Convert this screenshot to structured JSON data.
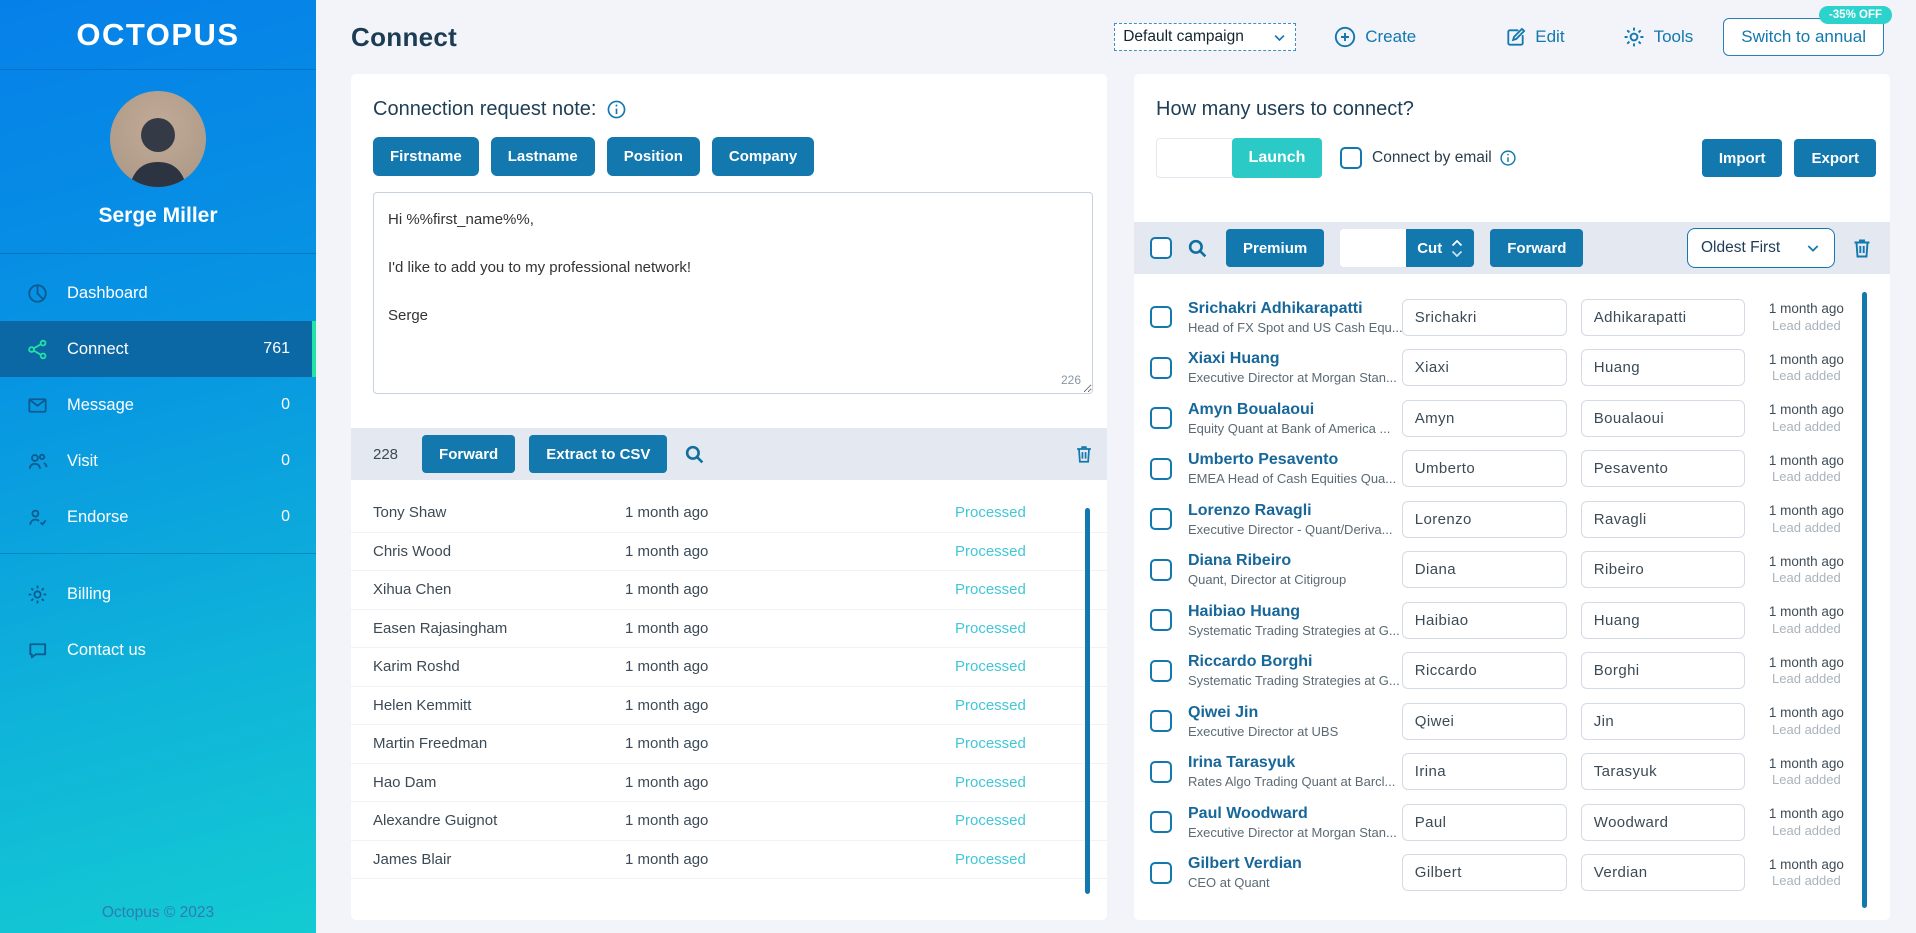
{
  "sidebar": {
    "logo": "OCTOPUS",
    "user_name": "Serge Miller",
    "menu": [
      {
        "label": "Dashboard",
        "icon": "dashboard",
        "count": "",
        "active": false
      },
      {
        "label": "Connect",
        "icon": "connect",
        "count": "761",
        "active": true
      },
      {
        "label": "Message",
        "icon": "message",
        "count": "0",
        "active": false
      },
      {
        "label": "Visit",
        "icon": "visit",
        "count": "0",
        "active": false
      },
      {
        "label": "Endorse",
        "icon": "endorse",
        "count": "0",
        "active": false
      }
    ],
    "secondary": [
      {
        "label": "Billing",
        "icon": "billing"
      },
      {
        "label": "Contact us",
        "icon": "contact"
      }
    ],
    "footer": "Octopus © 2023"
  },
  "header": {
    "title": "Connect",
    "campaign_select": "Default campaign",
    "create_label": "Create",
    "edit_label": "Edit",
    "tools_label": "Tools",
    "switch_annual_label": "Switch to annual",
    "discount_badge": "-35% OFF"
  },
  "note_panel": {
    "title": "Connection request note:",
    "tokens": [
      "Firstname",
      "Lastname",
      "Position",
      "Company"
    ],
    "note_text": "Hi %%first_name%%,\n\nI'd like to add you to my professional network!\n\nSerge",
    "char_count": "226",
    "queue_count": "228",
    "forward_label": "Forward",
    "extract_label": "Extract to CSV",
    "rows": [
      {
        "name": "Tony Shaw",
        "time": "1 month ago",
        "status": "Processed"
      },
      {
        "name": "Chris Wood",
        "time": "1 month ago",
        "status": "Processed"
      },
      {
        "name": "Xihua Chen",
        "time": "1 month ago",
        "status": "Processed"
      },
      {
        "name": "Easen Rajasingham",
        "time": "1 month ago",
        "status": "Processed"
      },
      {
        "name": "Karim Roshd",
        "time": "1 month ago",
        "status": "Processed"
      },
      {
        "name": "Helen Kemmitt",
        "time": "1 month ago",
        "status": "Processed"
      },
      {
        "name": "Martin Freedman",
        "time": "1 month ago",
        "status": "Processed"
      },
      {
        "name": "Hao Dam",
        "time": "1 month ago",
        "status": "Processed"
      },
      {
        "name": "Alexandre Guignot",
        "time": "1 month ago",
        "status": "Processed"
      },
      {
        "name": "James Blair",
        "time": "1 month ago",
        "status": "Processed"
      }
    ]
  },
  "connect_panel": {
    "title": "How many users to connect?",
    "launch_label": "Launch",
    "email_label": "Connect by email",
    "import_label": "Import",
    "export_label": "Export",
    "premium_label": "Premium",
    "cut_label": "Cut",
    "forward_label": "Forward",
    "sort_value": "Oldest First",
    "users": [
      {
        "name": "Srichakri Adhikarapatti",
        "subtitle": "Head of FX Spot and US Cash Equ...",
        "first": "Srichakri",
        "last": "Adhikarapatti",
        "time": "1 month ago",
        "status": "Lead added"
      },
      {
        "name": "Xiaxi Huang",
        "subtitle": "Executive Director at Morgan Stan...",
        "first": "Xiaxi",
        "last": "Huang",
        "time": "1 month ago",
        "status": "Lead added"
      },
      {
        "name": "Amyn Boualaoui",
        "subtitle": "Equity Quant at Bank of America ...",
        "first": "Amyn",
        "last": "Boualaoui",
        "time": "1 month ago",
        "status": "Lead added"
      },
      {
        "name": "Umberto Pesavento",
        "subtitle": "EMEA Head of Cash Equities Qua...",
        "first": "Umberto",
        "last": "Pesavento",
        "time": "1 month ago",
        "status": "Lead added"
      },
      {
        "name": "Lorenzo Ravagli",
        "subtitle": "Executive Director - Quant/Deriva...",
        "first": "Lorenzo",
        "last": "Ravagli",
        "time": "1 month ago",
        "status": "Lead added"
      },
      {
        "name": "Diana Ribeiro",
        "subtitle": "Quant, Director at Citigroup",
        "first": "Diana",
        "last": "Ribeiro",
        "time": "1 month ago",
        "status": "Lead added"
      },
      {
        "name": "Haibiao Huang",
        "subtitle": "Systematic Trading Strategies at G...",
        "first": "Haibiao",
        "last": "Huang",
        "time": "1 month ago",
        "status": "Lead added"
      },
      {
        "name": "Riccardo Borghi",
        "subtitle": "Systematic Trading Strategies at G...",
        "first": "Riccardo",
        "last": "Borghi",
        "time": "1 month ago",
        "status": "Lead added"
      },
      {
        "name": "Qiwei Jin",
        "subtitle": "Executive Director at UBS",
        "first": "Qiwei",
        "last": "Jin",
        "time": "1 month ago",
        "status": "Lead added"
      },
      {
        "name": "Irina Tarasyuk",
        "subtitle": "Rates Algo Trading Quant at Barcl...",
        "first": "Irina",
        "last": "Tarasyuk",
        "time": "1 month ago",
        "status": "Lead added"
      },
      {
        "name": "Paul Woodward",
        "subtitle": "Executive Director at Morgan Stan...",
        "first": "Paul",
        "last": "Woodward",
        "time": "1 month ago",
        "status": "Lead added"
      },
      {
        "name": "Gilbert Verdian",
        "subtitle": "CEO at Quant",
        "first": "Gilbert",
        "last": "Verdian",
        "time": "1 month ago",
        "status": "Lead added"
      }
    ]
  },
  "colors": {
    "accent_blue": "#1278ad",
    "teal_button": "#2bcac6",
    "processed_teal": "#41c7d6",
    "active_green": "#22e3a6",
    "badge_teal": "#2bd3cc"
  }
}
